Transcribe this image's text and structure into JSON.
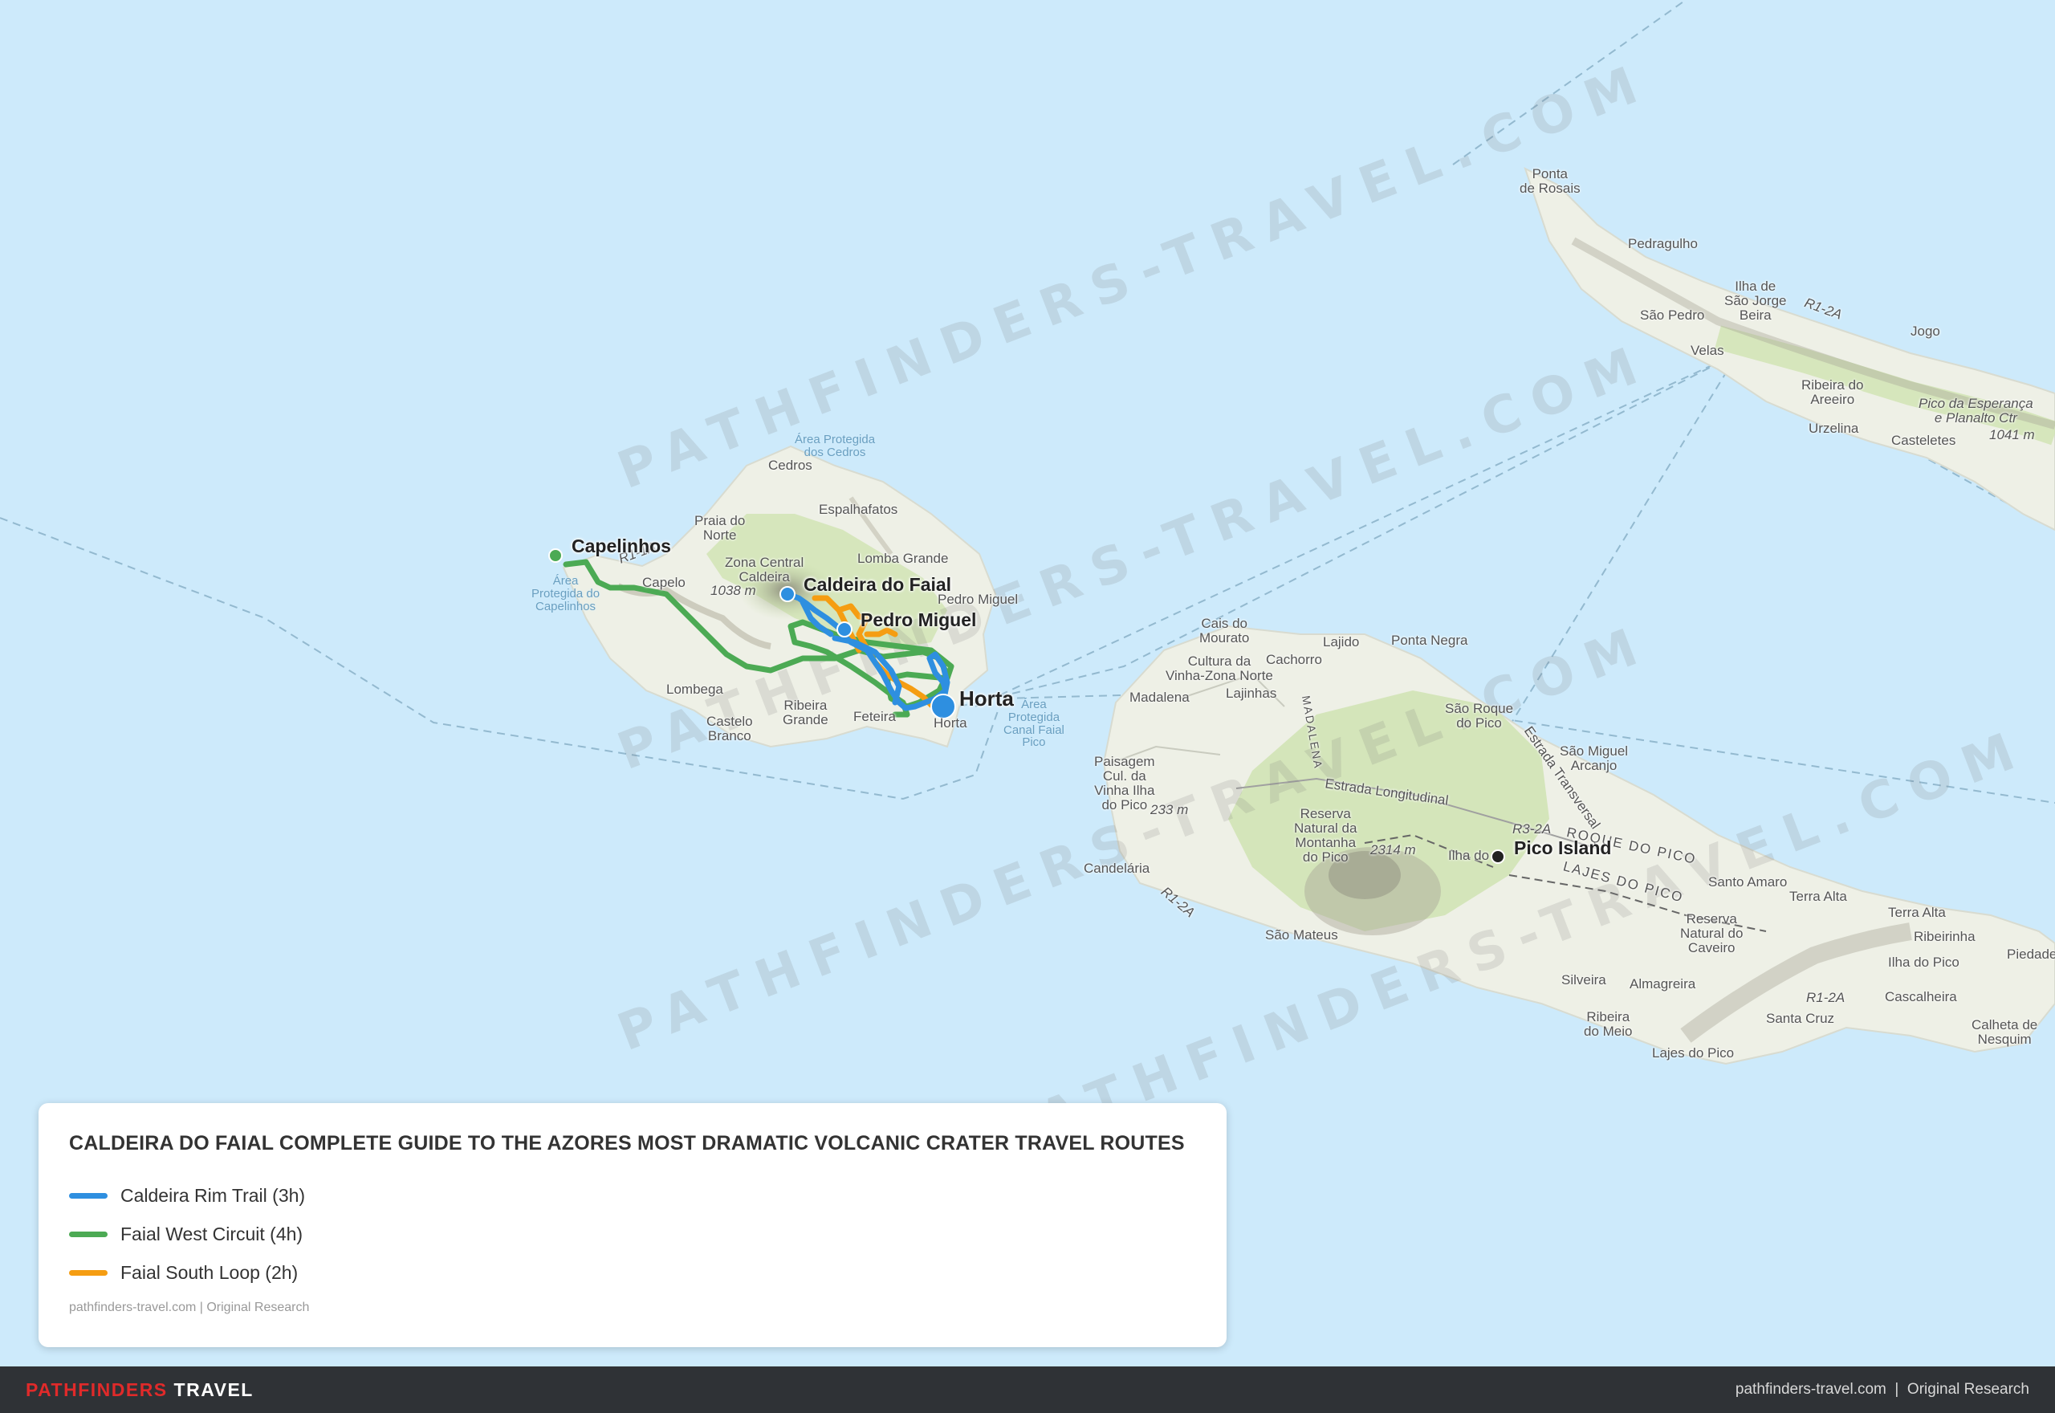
{
  "map": {
    "watermark_text": "PATHFINDERS-TRAVEL.COM",
    "colors": {
      "water": "#cdeafb",
      "land": "#eef0e6",
      "vegetation": "#cfe3b1",
      "relief": "#a8a596"
    },
    "places": {
      "ponta_de_rosais": "Ponta\nde Rosais",
      "pedragulho": "Pedragulho",
      "ilha_de_sao_jorge": "Ilha de\nSão Jorge\nBeira",
      "sao_pedro": "São Pedro",
      "velas": "Velas",
      "jogo": "Jogo",
      "ribeira_do_areeiro": "Ribeira do\nAreeiro",
      "pico_da_esperanca": "Pico da Esperança\ne Planalto Ctr",
      "elev_1041": "1041 m",
      "urzelina": "Urzelina",
      "casteletes": "Casteletes",
      "r1_2a_sj": "R1-2A",
      "area_protegida_cedros": "Área Protegida\ndos Cedros",
      "cedros": "Cedros",
      "espalhafatos": "Espalhafatos",
      "praia_do_norte": "Praia do\nNorte",
      "zona_central_caldeira": "Zona Central\nCaldeira",
      "lomba_grande": "Lomba Grande",
      "elev_1038": "1038 m",
      "capelo": "Capelo",
      "area_protegida_capelinhos": "Área\nProtegida do\nCapelinhos",
      "r1_1a": "R1-1A",
      "pedro_miguel_small": "Pedro Miguel",
      "lombega": "Lombega",
      "castelo_branco": "Castelo\nBranco",
      "ribeira_grande": "Ribeira\nGrande",
      "feteira": "Feteira",
      "horta_small": "Horta",
      "area_canal_faial_pico": "Área\nProtegida\nCanal Faial\nPico",
      "cais_do_mourato": "Cais do\nMourato",
      "lajido": "Lajido",
      "ponta_negra": "Ponta Negra",
      "cachorro": "Cachorro",
      "cultura_vinha": "Cultura da\nVinha-Zona Norte",
      "madalena": "Madalena",
      "lajinhas": "Lajinhas",
      "madalena_road": "MADALENA",
      "sao_roque_do_pico": "São Roque\ndo Pico",
      "sao_miguel_arcanjo": "São Miguel\nArcanjo",
      "estrada_transversal": "Estrada Transversal",
      "estrada_longitudinal": "Estrada Longitudinal",
      "paisagem_vinha": "Paisagem\nCul. da\nVinha Ilha\ndo Pico",
      "elev_233": "233 m",
      "reserva_montanha": "Reserva\nNatural da\nMontanha\ndo Pico",
      "elev_2314": "2314 m",
      "ilha_do_pico": "Ilha do",
      "roque_do_pico": "ROQUE DO PICO",
      "lajes_do_pico_road": "LAJES DO PICO",
      "r3_2a": "R3-2A",
      "candelaria": "Candelária",
      "r1_2a_pico": "R1-2A",
      "santo_amaro": "Santo Amaro",
      "terra_alta_1": "Terra Alta",
      "terra_alta_2": "Terra Alta",
      "reserva_caveiro": "Reserva\nNatural do\nCaveiro",
      "ribeirinha": "Ribeirinha",
      "ilha_do_pico_2": "Ilha do Pico",
      "piedade": "Piedade",
      "sao_mateus": "São Mateus",
      "silveira": "Silveira",
      "almagreira": "Almagreira",
      "cascalheira": "Cascalheira",
      "santa_cruz": "Santa Cruz",
      "r1_2a_pico_2": "R1-2A",
      "ribeira_do_meio": "Ribeira\ndo Meio",
      "lajes_do_pico": "Lajes do Pico",
      "calheta_de_nesquim": "Calheta de\nNesquim"
    },
    "markers": {
      "capelinhos": "Capelinhos",
      "caldeira": "Caldeira do Faial",
      "pedro_miguel": "Pedro Miguel",
      "horta": "Horta",
      "pico_island": "Pico Island"
    }
  },
  "legend": {
    "title": "CALDEIRA DO FAIAL COMPLETE GUIDE TO THE AZORES MOST DRAMATIC VOLCANIC CRATER TRAVEL ROUTES",
    "routes": [
      {
        "label": "Caldeira Rim Trail (3h)",
        "color": "#2e8fe0"
      },
      {
        "label": "Faial West Circuit (4h)",
        "color": "#4caa54"
      },
      {
        "label": "Faial South Loop (2h)",
        "color": "#f59d12"
      }
    ],
    "credit": "pathfinders-travel.com | Original Research"
  },
  "footer": {
    "brand_red": "PATHFINDERS",
    "brand_white": "TRAVEL",
    "right_text": "pathfinders-travel.com  |  Original Research"
  }
}
